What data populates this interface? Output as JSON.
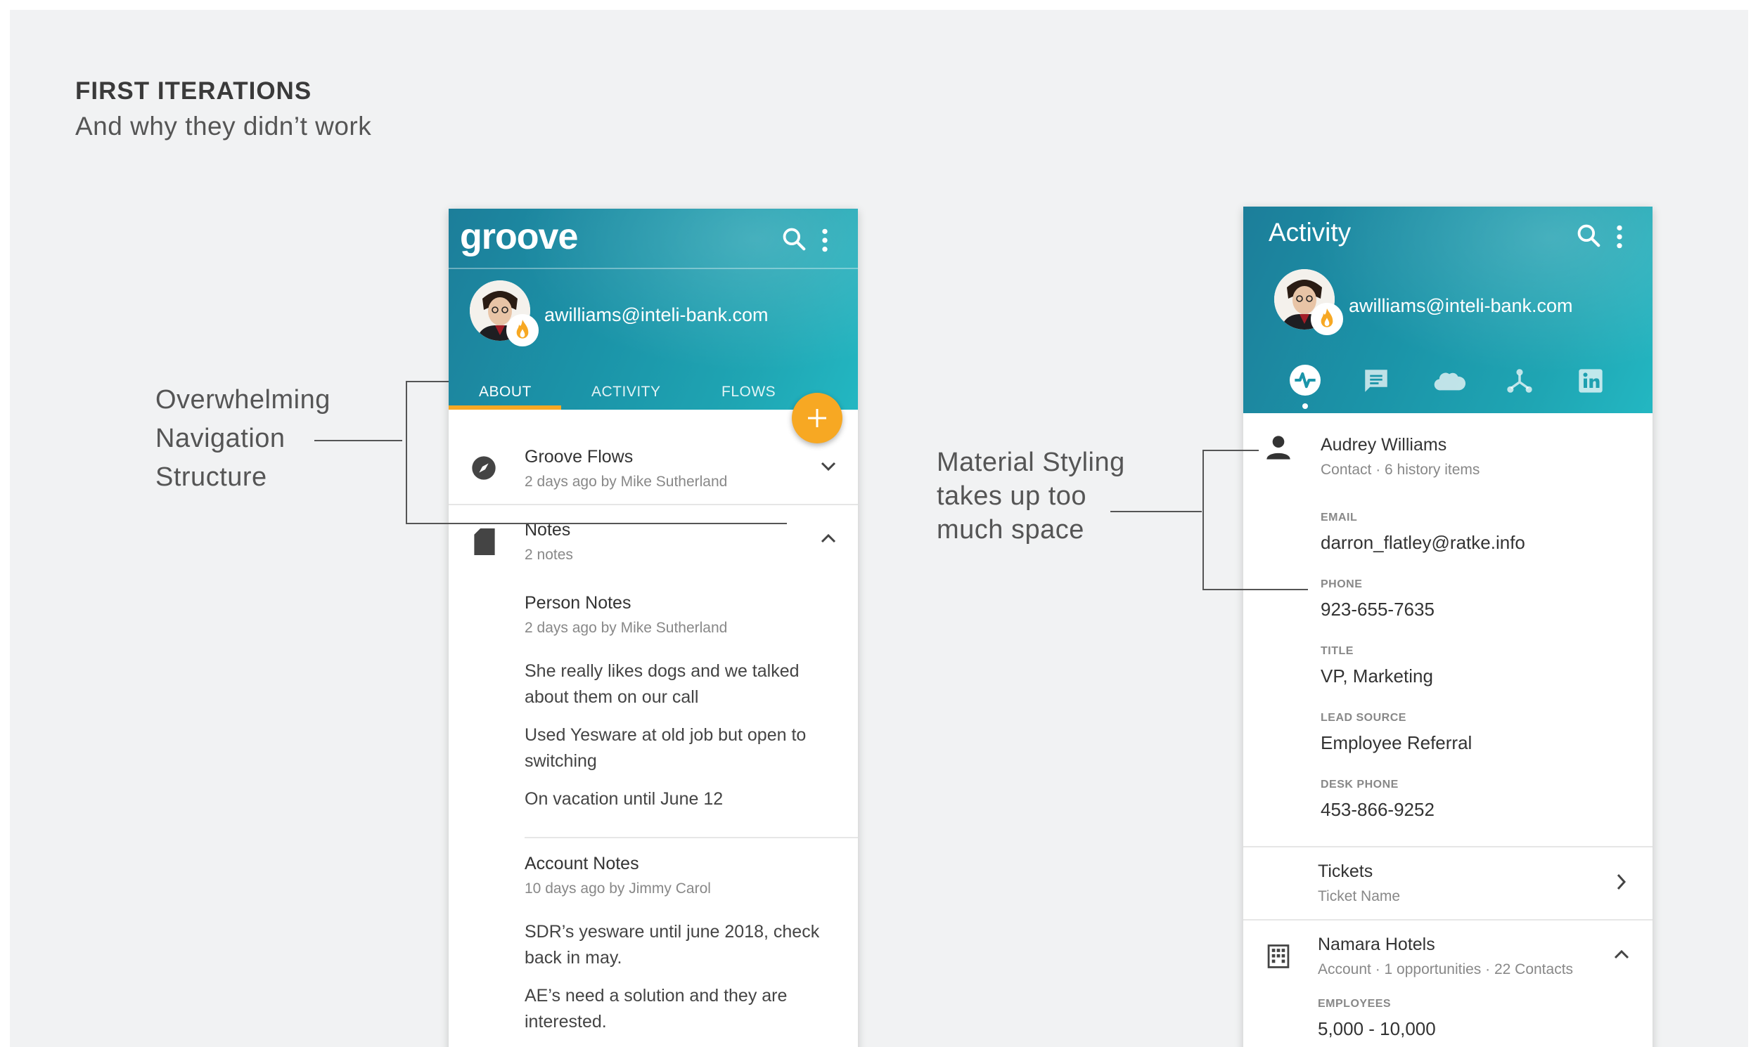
{
  "page": {
    "title": "FIRST ITERATIONS",
    "subtitle": "And why they didn’t work"
  },
  "annotations": {
    "left": [
      "Overwhelming",
      "Navigation",
      "Structure"
    ],
    "right": [
      "Material Styling",
      "takes up too",
      "much space"
    ]
  },
  "phone1": {
    "logo": "groove",
    "email": "awilliams@inteli-bank.com",
    "tabs": [
      {
        "label": "ABOUT",
        "active": true
      },
      {
        "label": "ACTIVITY",
        "active": false
      },
      {
        "label": "FLOWS",
        "active": false
      }
    ],
    "groove_flows": {
      "title": "Groove Flows",
      "meta": "2 days ago by Mike Sutherland"
    },
    "notes": {
      "title": "Notes",
      "meta": "2 notes"
    },
    "person_notes": {
      "title": "Person Notes",
      "meta": "2 days ago by Mike Sutherland",
      "items": [
        [
          "She really likes dogs and we talked",
          "about them on our call"
        ],
        [
          "Used Yesware at old job but open to",
          "switching"
        ],
        [
          "On vacation until June 12"
        ]
      ]
    },
    "account_notes": {
      "title": "Account Notes",
      "meta": "10 days ago by Jimmy Carol",
      "items": [
        [
          "SDR’s yesware until june 2018, check",
          "back in may."
        ],
        [
          "AE’s need a solution and they are",
          "interested."
        ]
      ]
    }
  },
  "phone2": {
    "title": "Activity",
    "email": "awilliams@inteli-bank.com",
    "tab_icons": [
      "activity-icon",
      "chat-icon",
      "salesforce-cloud-icon",
      "hierarchy-icon",
      "linkedin-icon"
    ],
    "contact": {
      "name": "Audrey Williams",
      "meta": "Contact · 6 history items"
    },
    "fields": [
      {
        "label": "EMAIL",
        "value": "darron_flatley@ratke.info"
      },
      {
        "label": "PHONE",
        "value": "923-655-7635"
      },
      {
        "label": "TITLE",
        "value": "VP, Marketing"
      },
      {
        "label": "LEAD SOURCE",
        "value": "Employee Referral"
      },
      {
        "label": "DESK PHONE",
        "value": "453-866-9252"
      }
    ],
    "tickets": {
      "title": "Tickets",
      "meta": "Ticket Name"
    },
    "account": {
      "name": "Namara Hotels",
      "meta": "Account · 1 opportunities · 22 Contacts"
    },
    "account_fields": [
      {
        "label": "EMPLOYEES",
        "value": "5,000 - 10,000"
      }
    ]
  },
  "colors": {
    "header_start": "#1c7e9a",
    "header_end": "#23b7c2",
    "accent": "#f7a823",
    "text": "#333333"
  }
}
